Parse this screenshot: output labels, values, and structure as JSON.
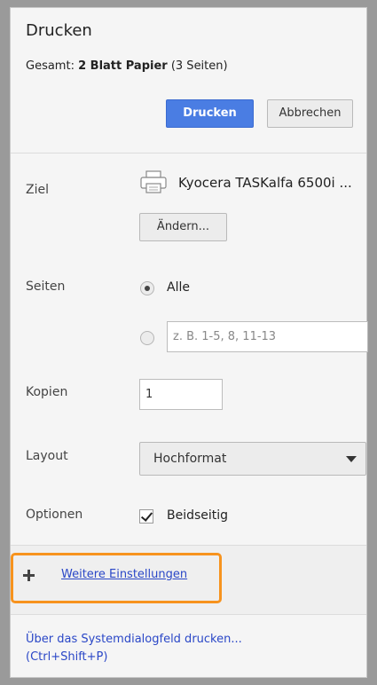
{
  "header": {
    "title": "Drucken",
    "summary_prefix": "Gesamt: ",
    "summary_bold": "2 Blatt Papier",
    "summary_suffix": " (3 Seiten)",
    "print_label": "Drucken",
    "cancel_label": "Abbrechen"
  },
  "destination": {
    "label": "Ziel",
    "printer_name": "Kyocera TASKalfa 6500i ...",
    "icon": "printer-icon",
    "change_label": "Ändern..."
  },
  "pages": {
    "label": "Seiten",
    "all_label": "Alle",
    "all_selected": true,
    "custom_placeholder": "z. B. 1-5, 8, 11-13"
  },
  "copies": {
    "label": "Kopien",
    "value": "1"
  },
  "layout": {
    "label": "Layout",
    "selected": "Hochformat"
  },
  "options": {
    "label": "Optionen",
    "duplex_label": "Beidseitig",
    "duplex_checked": true
  },
  "more_settings": {
    "label": "Weitere Einstellungen",
    "highlight_color": "#f7931e"
  },
  "system_dialog": {
    "line1": "Über das Systemdialogfeld drucken...",
    "line2": "(Ctrl+Shift+P)"
  },
  "colors": {
    "accent": "#4a7de3",
    "link": "#2a47c7"
  }
}
